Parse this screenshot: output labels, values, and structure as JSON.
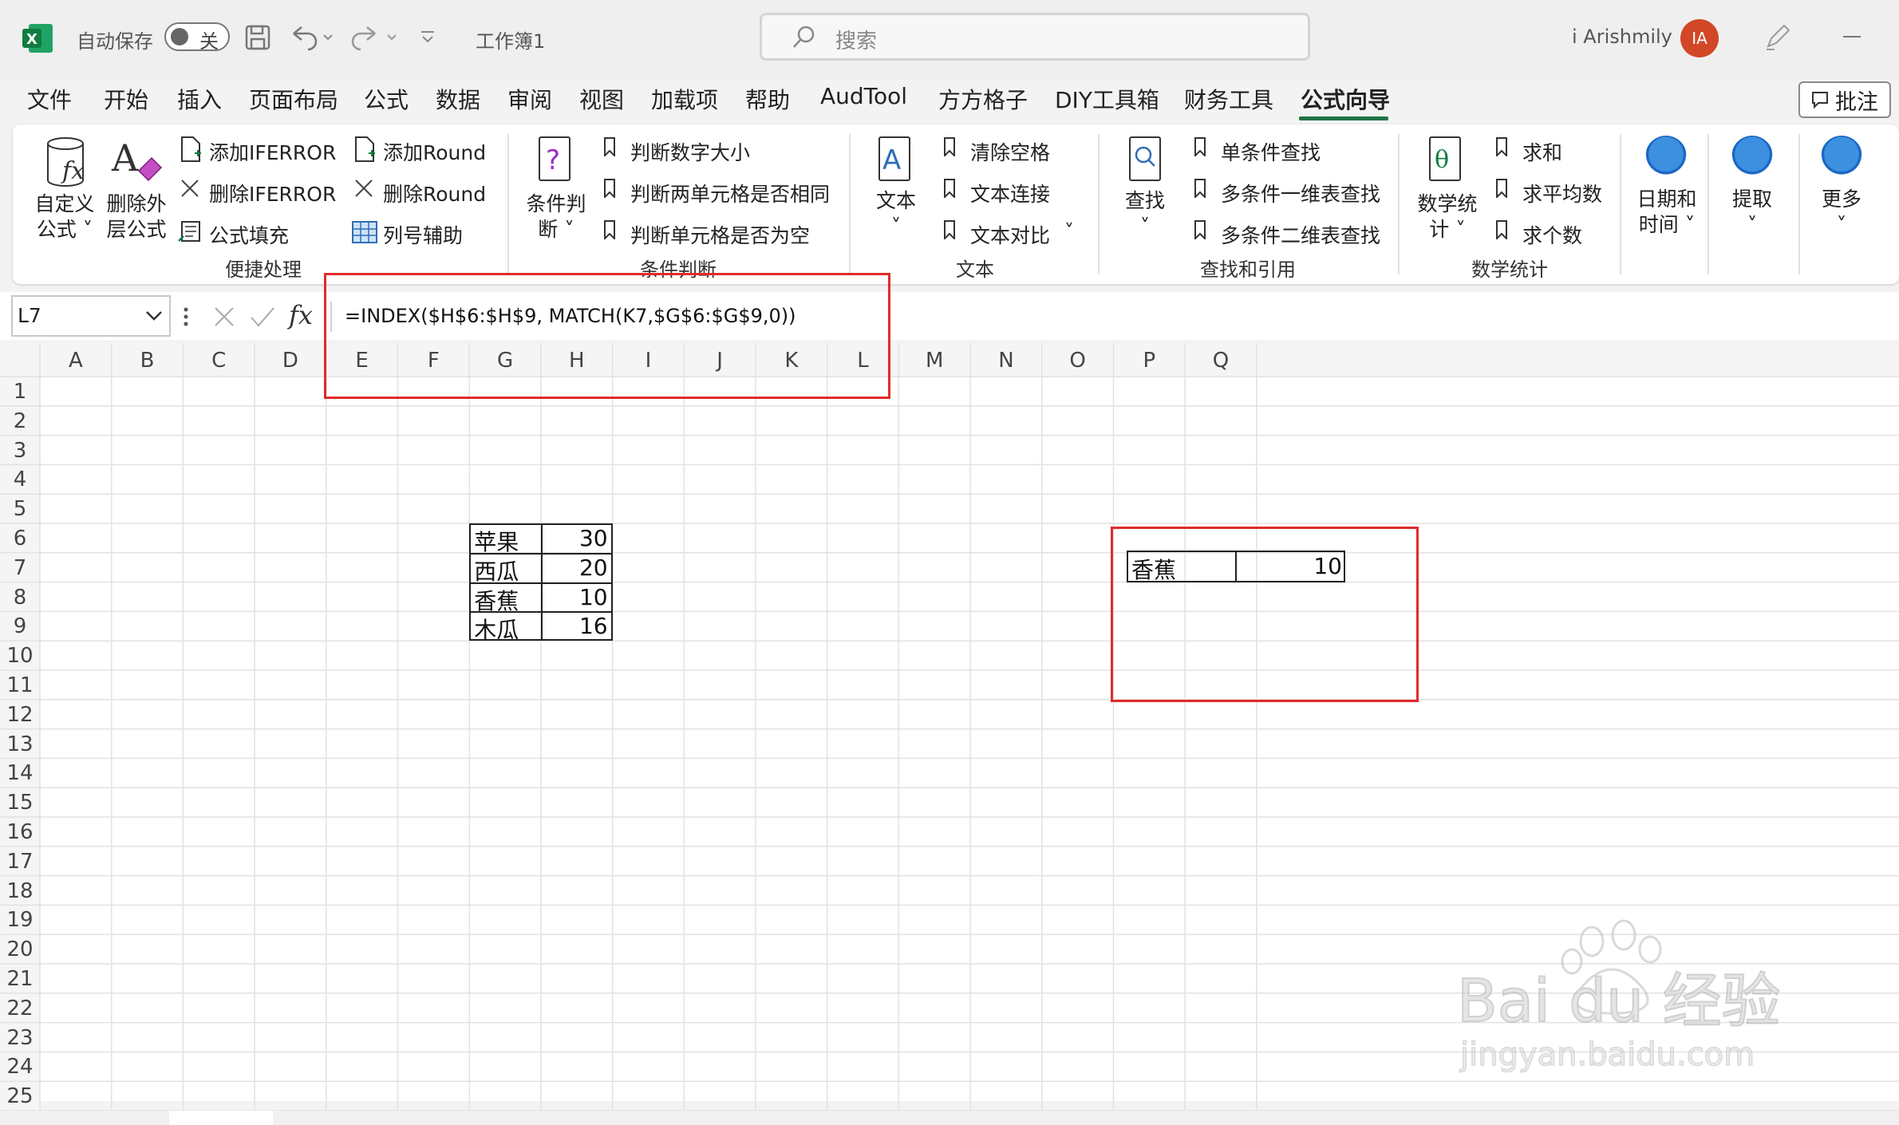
{
  "titlebar": {
    "autosave_label": "自动保存",
    "autosave_state": "关",
    "doc_title": "工作簿1",
    "search_placeholder": "搜索",
    "user_name": "i Arishmily",
    "user_initials": "IA"
  },
  "menu": {
    "tabs": [
      "文件",
      "开始",
      "插入",
      "页面布局",
      "公式",
      "数据",
      "审阅",
      "视图",
      "加载项",
      "帮助",
      "AudTool",
      "方方格子",
      "DIY工具箱",
      "财务工具",
      "公式向导"
    ],
    "active_tab": "公式向导",
    "annotation_button": "批注"
  },
  "ribbon": {
    "g1": {
      "custom_formula": [
        "自定义",
        "公式"
      ],
      "remove_outer": [
        "删除外",
        "层公式"
      ],
      "items": [
        "添加IFERROR",
        "删除IFERROR",
        "公式填充",
        "添加Round",
        "删除Round",
        "列号辅助"
      ],
      "label": "便捷处理"
    },
    "g2": {
      "condition": [
        "条件判",
        "断"
      ],
      "items": [
        "判断数字大小",
        "判断两单元格是否相同",
        "判断单元格是否为空"
      ],
      "label": "条件判断"
    },
    "g3": {
      "text_btn": "文本",
      "items": [
        "清除空格",
        "文本连接",
        "文本对比"
      ],
      "label": "文本"
    },
    "g4": {
      "lookup_btn": "查找",
      "items": [
        "单条件查找",
        "多条件一维表查找",
        "多条件二维表查找"
      ],
      "label": "查找和引用"
    },
    "g5": {
      "math_btn": [
        "数学统",
        "计"
      ],
      "items": [
        "求和",
        "求平均数",
        "求个数"
      ],
      "label": "数学统计"
    },
    "g6": {
      "datetime": [
        "日期和",
        "时间"
      ],
      "extract": "提取",
      "more": "更多"
    }
  },
  "formula_bar": {
    "name_box": "L7",
    "formula": "=INDEX($H$6:$H$9, MATCH(K7,$G$6:$G$9,0))"
  },
  "sheet": {
    "columns": [
      "A",
      "B",
      "C",
      "D",
      "E",
      "F",
      "G",
      "H",
      "I",
      "J",
      "K",
      "L",
      "M",
      "N",
      "O",
      "P",
      "Q"
    ],
    "rows": [
      "1",
      "2",
      "3",
      "4",
      "5",
      "6",
      "7",
      "8",
      "9",
      "10",
      "11",
      "12",
      "13",
      "14",
      "15",
      "16",
      "17",
      "18",
      "19",
      "20",
      "21",
      "22",
      "23",
      "24",
      "25"
    ],
    "table": [
      {
        "name": "苹果",
        "value": "30"
      },
      {
        "name": "西瓜",
        "value": "20"
      },
      {
        "name": "香蕉",
        "value": "10"
      },
      {
        "name": "木瓜",
        "value": "16"
      }
    ],
    "lookup": {
      "key": "香蕉",
      "result": "10"
    }
  },
  "watermark": {
    "brand": "Bai du 经验",
    "url": "jingyan.baidu.com"
  },
  "colors": {
    "excel_green": "#217346",
    "red_box": "#e12b2b",
    "avatar": "#d24726"
  }
}
